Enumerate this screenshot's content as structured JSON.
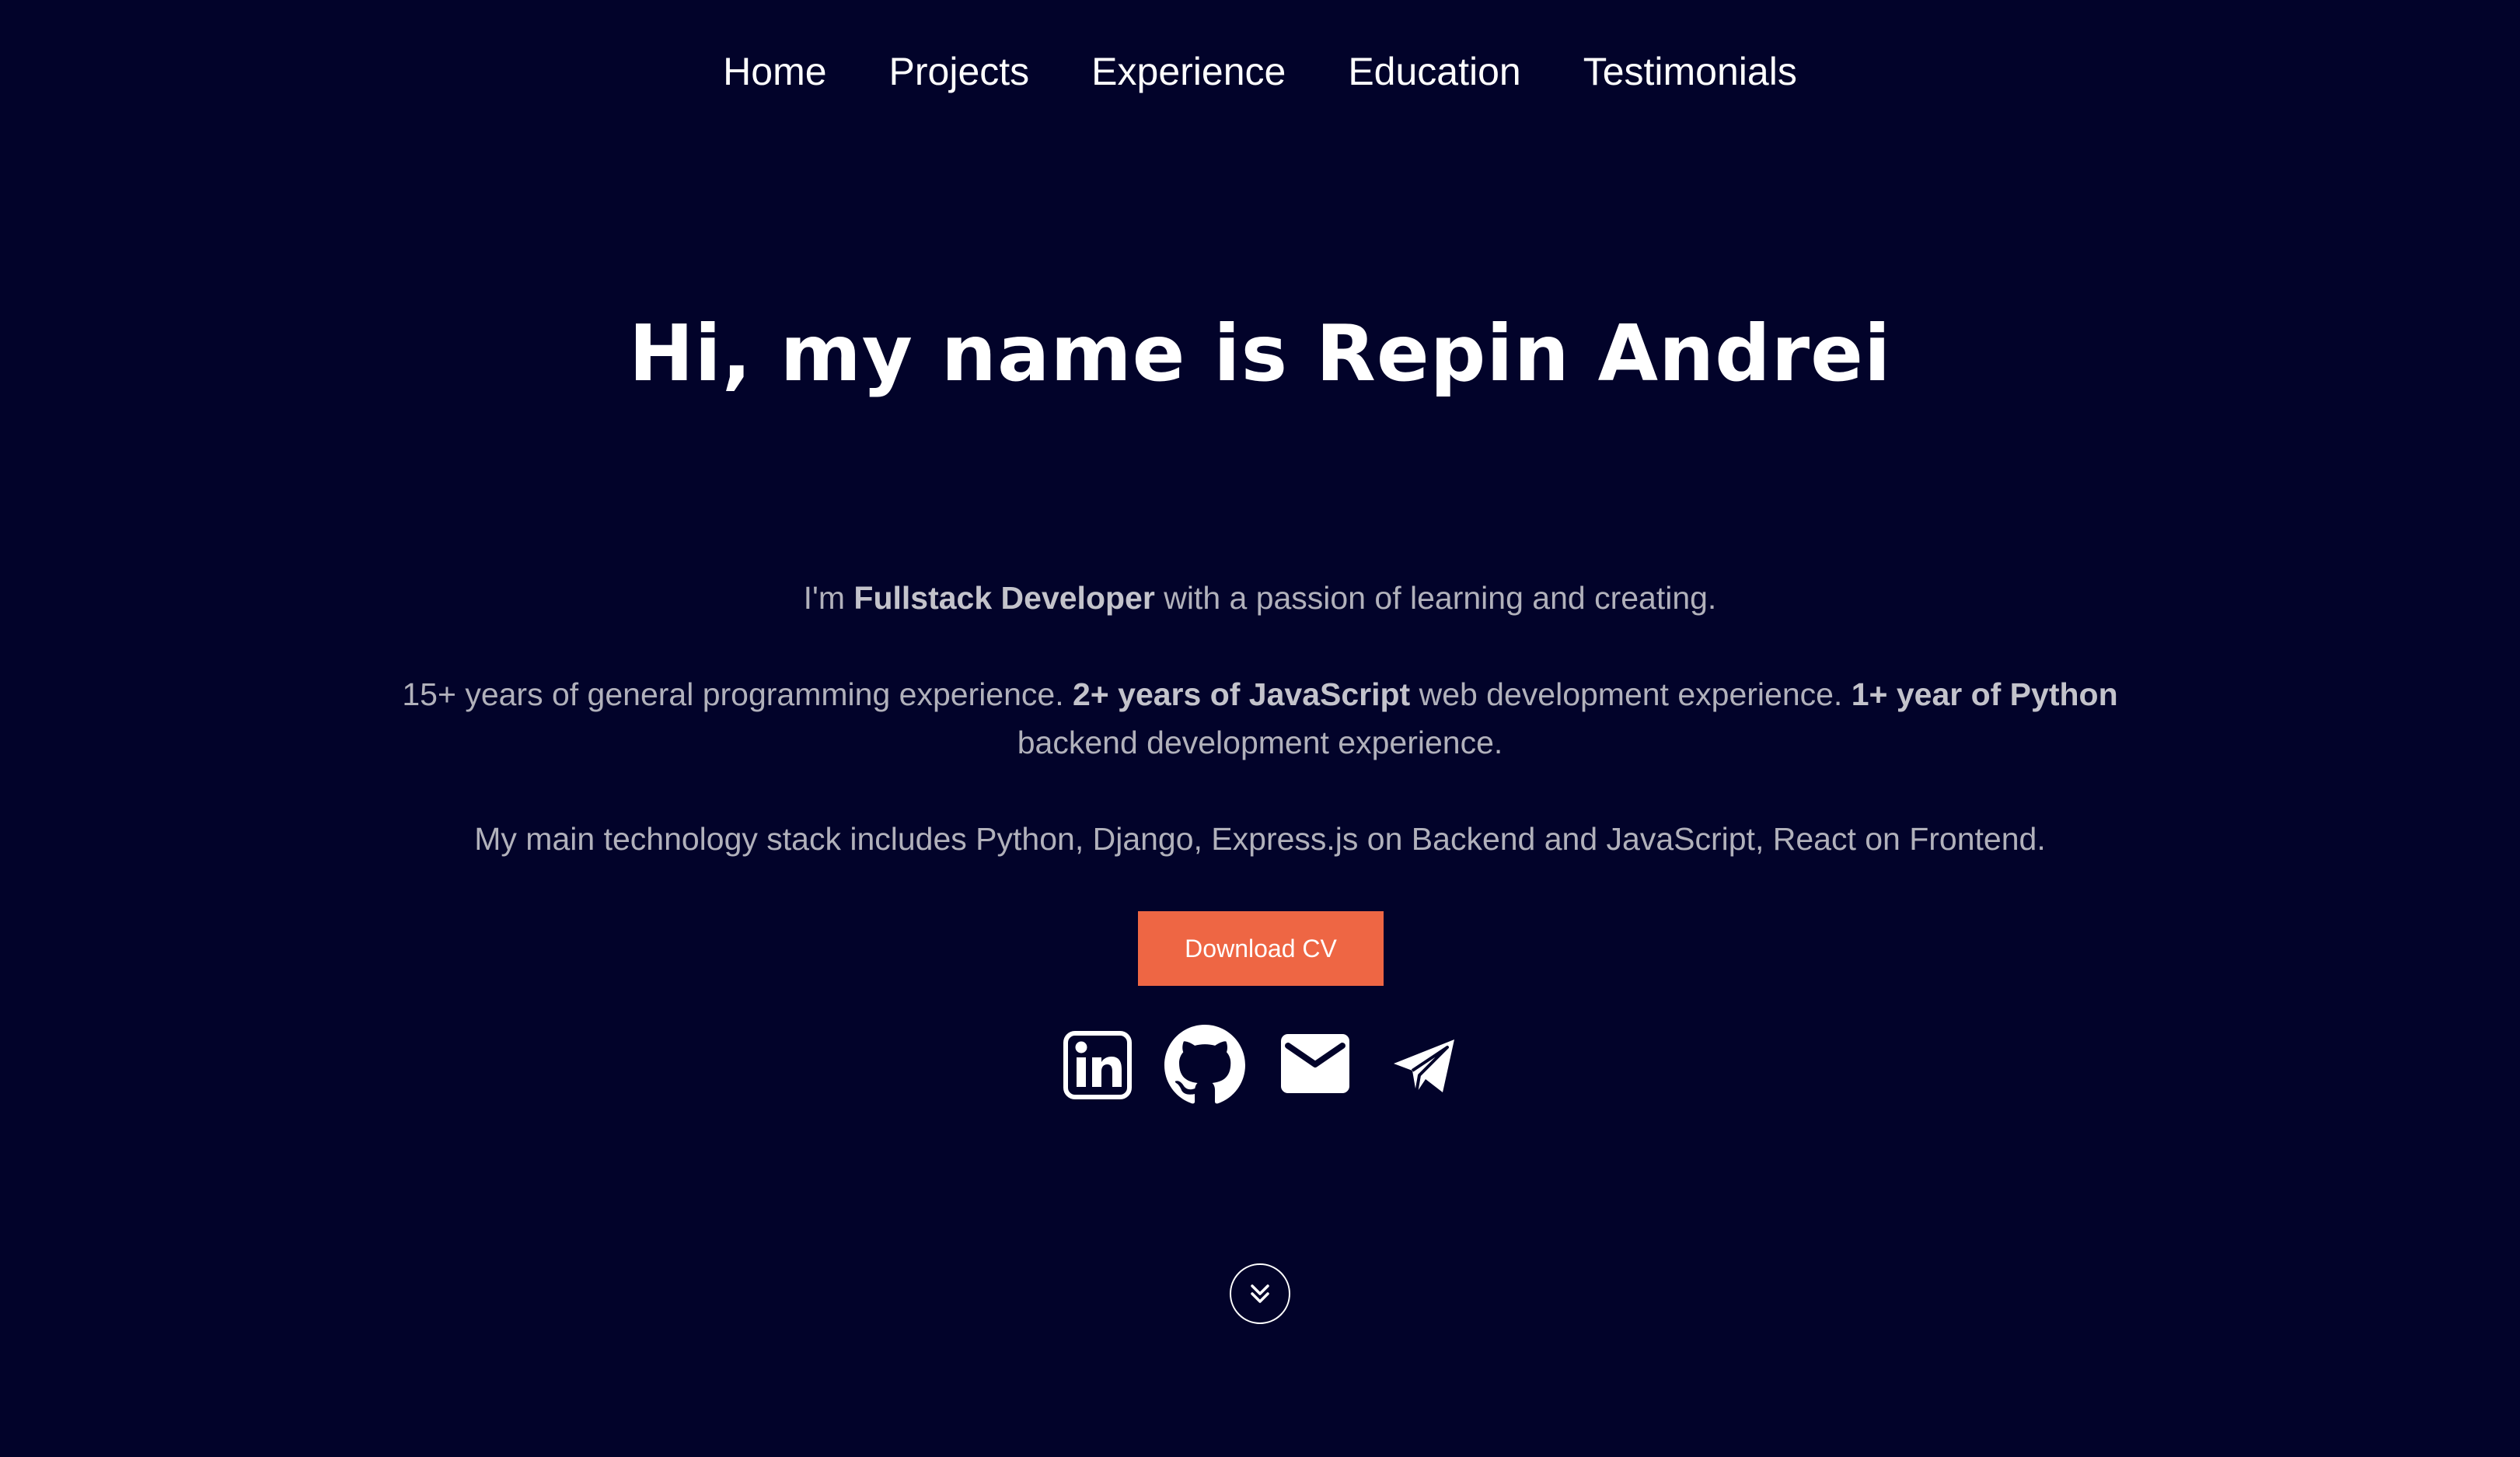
{
  "nav": {
    "items": [
      {
        "label": "Home"
      },
      {
        "label": "Projects"
      },
      {
        "label": "Experience"
      },
      {
        "label": "Education"
      },
      {
        "label": "Testimonials"
      }
    ]
  },
  "hero": {
    "title": "Hi, my name is Repin Andrei",
    "intro": {
      "before": "I'm ",
      "role": "Fullstack Developer",
      "after": " with a passion of learning and creating."
    },
    "experience": {
      "part1": "15+ years of general programming experience. ",
      "js": "2+ years of JavaScript",
      "part2": " web development experience. ",
      "python": "1+ year of Python",
      "part3": " backend development experience."
    },
    "stack": "My main technology stack includes Python, Django, Express.js on Backend and JavaScript, React on Frontend.",
    "download_label": "Download CV"
  },
  "social": [
    {
      "icon": "linkedin-icon"
    },
    {
      "icon": "github-icon"
    },
    {
      "icon": "mail-icon"
    },
    {
      "icon": "telegram-icon"
    }
  ],
  "colors": {
    "background": "#02032a",
    "accent": "#ee6644",
    "text": "#ffffff",
    "muted_text": "#b1b1bb"
  }
}
